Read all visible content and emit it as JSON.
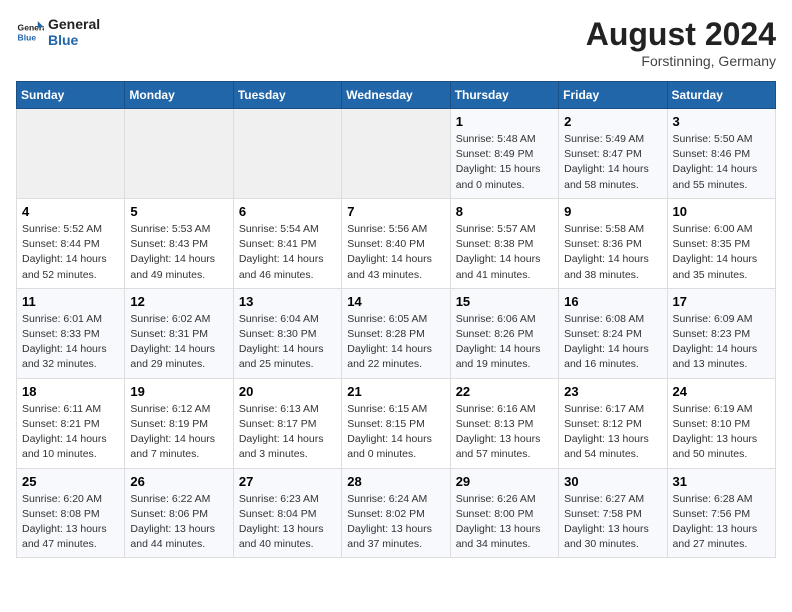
{
  "logo": {
    "line1": "General",
    "line2": "Blue"
  },
  "title": "August 2024",
  "location": "Forstinning, Germany",
  "headers": [
    "Sunday",
    "Monday",
    "Tuesday",
    "Wednesday",
    "Thursday",
    "Friday",
    "Saturday"
  ],
  "weeks": [
    [
      {
        "day": "",
        "info": ""
      },
      {
        "day": "",
        "info": ""
      },
      {
        "day": "",
        "info": ""
      },
      {
        "day": "",
        "info": ""
      },
      {
        "day": "1",
        "info": "Sunrise: 5:48 AM\nSunset: 8:49 PM\nDaylight: 15 hours\nand 0 minutes."
      },
      {
        "day": "2",
        "info": "Sunrise: 5:49 AM\nSunset: 8:47 PM\nDaylight: 14 hours\nand 58 minutes."
      },
      {
        "day": "3",
        "info": "Sunrise: 5:50 AM\nSunset: 8:46 PM\nDaylight: 14 hours\nand 55 minutes."
      }
    ],
    [
      {
        "day": "4",
        "info": "Sunrise: 5:52 AM\nSunset: 8:44 PM\nDaylight: 14 hours\nand 52 minutes."
      },
      {
        "day": "5",
        "info": "Sunrise: 5:53 AM\nSunset: 8:43 PM\nDaylight: 14 hours\nand 49 minutes."
      },
      {
        "day": "6",
        "info": "Sunrise: 5:54 AM\nSunset: 8:41 PM\nDaylight: 14 hours\nand 46 minutes."
      },
      {
        "day": "7",
        "info": "Sunrise: 5:56 AM\nSunset: 8:40 PM\nDaylight: 14 hours\nand 43 minutes."
      },
      {
        "day": "8",
        "info": "Sunrise: 5:57 AM\nSunset: 8:38 PM\nDaylight: 14 hours\nand 41 minutes."
      },
      {
        "day": "9",
        "info": "Sunrise: 5:58 AM\nSunset: 8:36 PM\nDaylight: 14 hours\nand 38 minutes."
      },
      {
        "day": "10",
        "info": "Sunrise: 6:00 AM\nSunset: 8:35 PM\nDaylight: 14 hours\nand 35 minutes."
      }
    ],
    [
      {
        "day": "11",
        "info": "Sunrise: 6:01 AM\nSunset: 8:33 PM\nDaylight: 14 hours\nand 32 minutes."
      },
      {
        "day": "12",
        "info": "Sunrise: 6:02 AM\nSunset: 8:31 PM\nDaylight: 14 hours\nand 29 minutes."
      },
      {
        "day": "13",
        "info": "Sunrise: 6:04 AM\nSunset: 8:30 PM\nDaylight: 14 hours\nand 25 minutes."
      },
      {
        "day": "14",
        "info": "Sunrise: 6:05 AM\nSunset: 8:28 PM\nDaylight: 14 hours\nand 22 minutes."
      },
      {
        "day": "15",
        "info": "Sunrise: 6:06 AM\nSunset: 8:26 PM\nDaylight: 14 hours\nand 19 minutes."
      },
      {
        "day": "16",
        "info": "Sunrise: 6:08 AM\nSunset: 8:24 PM\nDaylight: 14 hours\nand 16 minutes."
      },
      {
        "day": "17",
        "info": "Sunrise: 6:09 AM\nSunset: 8:23 PM\nDaylight: 14 hours\nand 13 minutes."
      }
    ],
    [
      {
        "day": "18",
        "info": "Sunrise: 6:11 AM\nSunset: 8:21 PM\nDaylight: 14 hours\nand 10 minutes."
      },
      {
        "day": "19",
        "info": "Sunrise: 6:12 AM\nSunset: 8:19 PM\nDaylight: 14 hours\nand 7 minutes."
      },
      {
        "day": "20",
        "info": "Sunrise: 6:13 AM\nSunset: 8:17 PM\nDaylight: 14 hours\nand 3 minutes."
      },
      {
        "day": "21",
        "info": "Sunrise: 6:15 AM\nSunset: 8:15 PM\nDaylight: 14 hours\nand 0 minutes."
      },
      {
        "day": "22",
        "info": "Sunrise: 6:16 AM\nSunset: 8:13 PM\nDaylight: 13 hours\nand 57 minutes."
      },
      {
        "day": "23",
        "info": "Sunrise: 6:17 AM\nSunset: 8:12 PM\nDaylight: 13 hours\nand 54 minutes."
      },
      {
        "day": "24",
        "info": "Sunrise: 6:19 AM\nSunset: 8:10 PM\nDaylight: 13 hours\nand 50 minutes."
      }
    ],
    [
      {
        "day": "25",
        "info": "Sunrise: 6:20 AM\nSunset: 8:08 PM\nDaylight: 13 hours\nand 47 minutes."
      },
      {
        "day": "26",
        "info": "Sunrise: 6:22 AM\nSunset: 8:06 PM\nDaylight: 13 hours\nand 44 minutes."
      },
      {
        "day": "27",
        "info": "Sunrise: 6:23 AM\nSunset: 8:04 PM\nDaylight: 13 hours\nand 40 minutes."
      },
      {
        "day": "28",
        "info": "Sunrise: 6:24 AM\nSunset: 8:02 PM\nDaylight: 13 hours\nand 37 minutes."
      },
      {
        "day": "29",
        "info": "Sunrise: 6:26 AM\nSunset: 8:00 PM\nDaylight: 13 hours\nand 34 minutes."
      },
      {
        "day": "30",
        "info": "Sunrise: 6:27 AM\nSunset: 7:58 PM\nDaylight: 13 hours\nand 30 minutes."
      },
      {
        "day": "31",
        "info": "Sunrise: 6:28 AM\nSunset: 7:56 PM\nDaylight: 13 hours\nand 27 minutes."
      }
    ]
  ]
}
